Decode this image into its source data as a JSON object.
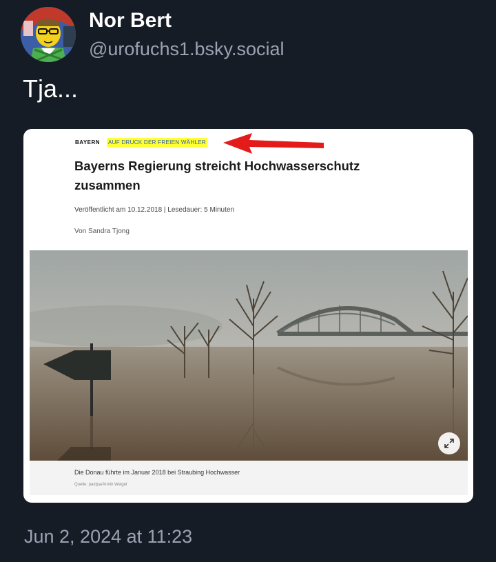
{
  "author": {
    "name": "Nor Bert",
    "handle": "@urofuchs1.bsky.social"
  },
  "post": {
    "text": "Tja...",
    "timestamp": "Jun 2, 2024 at 11:23"
  },
  "article": {
    "category": "BAYERN",
    "topline": "AUF DRUCK DER FREIEN WÄHLER",
    "headline": "Bayerns Regierung streicht Hochwasserschutz zusammen",
    "meta": "Veröffentlicht am 10.12.2018 | Lesedauer: 5 Minuten",
    "byline": "Von Sandra Tjong",
    "caption": "Die Donau führte im Januar 2018 bei Straubing Hochwasser",
    "credit": "Quelle: pa/dpa/Armin Weigel"
  },
  "colors": {
    "background": "#161c26",
    "highlight": "#ffff33",
    "arrow": "#e31b1b"
  },
  "icons": {
    "expand": "expand-arrows-icon",
    "arrow": "red-arrow-annotation"
  }
}
